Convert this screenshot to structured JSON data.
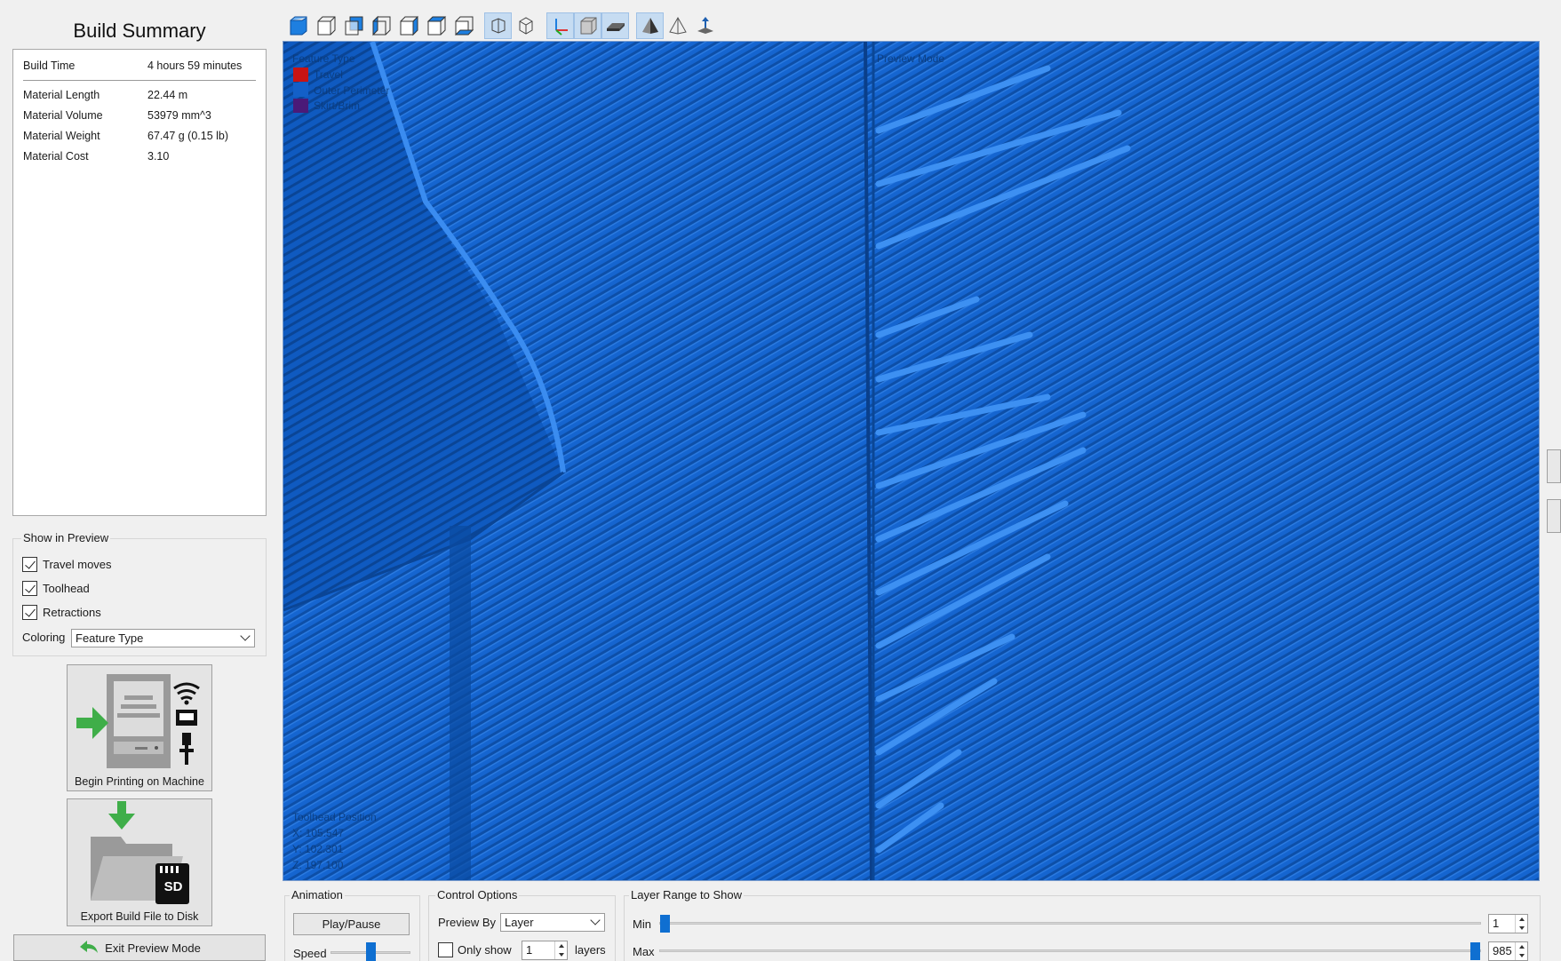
{
  "summary": {
    "title": "Build Summary",
    "rows": [
      {
        "key": "Build Time",
        "value": "4 hours 59 minutes"
      },
      {
        "key": "Material Length",
        "value": "22.44 m"
      },
      {
        "key": "Material Volume",
        "value": "53979 mm^3"
      },
      {
        "key": "Material Weight",
        "value": "67.47 g (0.15 lb)"
      },
      {
        "key": "Material Cost",
        "value": "3.10"
      }
    ]
  },
  "show_in_preview": {
    "title": "Show in Preview",
    "travel_moves": {
      "label": "Travel moves",
      "checked": true
    },
    "toolhead": {
      "label": "Toolhead",
      "checked": true
    },
    "retractions": {
      "label": "Retractions",
      "checked": true
    },
    "coloring_label": "Coloring",
    "coloring_value": "Feature Type"
  },
  "actions": {
    "begin_printing": "Begin Printing on Machine",
    "export_build": "Export Build File to Disk",
    "sd_label": "SD",
    "exit_preview": "Exit Preview Mode"
  },
  "toolbar": {
    "icons": [
      "view-iso-icon",
      "view-front-icon",
      "view-back-icon",
      "view-left-icon",
      "view-right-icon",
      "view-top-icon",
      "view-bottom-icon",
      "perspective-icon",
      "orthographic-icon",
      "axes-icon",
      "build-volume-icon",
      "bed-icon",
      "solid-model-icon",
      "wireframe-model-icon",
      "coordinate-icon"
    ],
    "active": [
      "perspective-icon",
      "axes-icon",
      "build-volume-icon",
      "bed-icon",
      "solid-model-icon"
    ]
  },
  "viewport": {
    "legend_title": "Feature Type",
    "legend": [
      {
        "label": "Travel",
        "color": "#c81414"
      },
      {
        "label": "Outer Perimeter",
        "color": "#1360c8"
      },
      {
        "label": "Skirt/Brim",
        "color": "#4a1a78"
      }
    ],
    "mode_label": "Preview Mode",
    "toolhead_title": "Toolhead Position",
    "toolhead_x": "X: 105.547",
    "toolhead_y": "Y: 102.301",
    "toolhead_z": "Z: 197.100",
    "background_color": "#1360c8"
  },
  "animation": {
    "title": "Animation",
    "play_pause": "Play/Pause",
    "speed_label": "Speed"
  },
  "control_options": {
    "title": "Control Options",
    "preview_by_label": "Preview By",
    "preview_by_value": "Layer",
    "only_show_label": "Only show",
    "only_show_checked": false,
    "only_show_value": "1",
    "layers_label": "layers"
  },
  "layer_range": {
    "title": "Layer Range to Show",
    "min_label": "Min",
    "min_value": "1",
    "max_label": "Max",
    "max_value": "985"
  }
}
